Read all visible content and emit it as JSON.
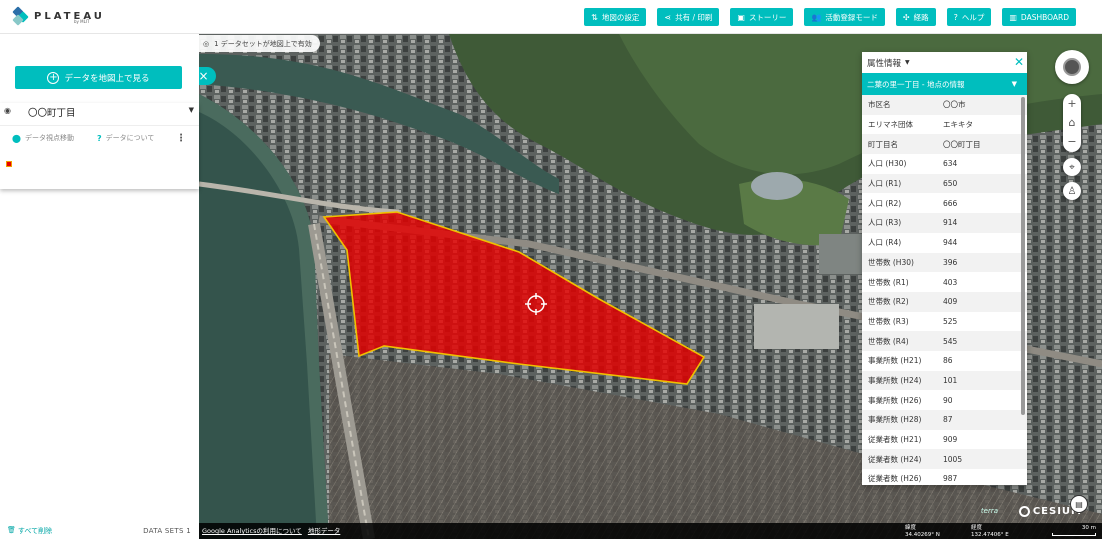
{
  "header": {
    "logo_text": "PLATEAU",
    "logo_sub": "by MLIT",
    "nav": [
      {
        "icon": "map-settings-icon",
        "glyph": "⇅",
        "label": "地図の設定"
      },
      {
        "icon": "share-icon",
        "glyph": "⋖",
        "label": "共有 / 印刷"
      },
      {
        "icon": "story-icon",
        "glyph": "▣",
        "label": "ストーリー"
      },
      {
        "icon": "activity-icon",
        "glyph": "👥",
        "label": "活動登録モード"
      },
      {
        "icon": "route-icon",
        "glyph": "✣",
        "label": "経路"
      },
      {
        "icon": "help-icon",
        "glyph": "?",
        "label": "ヘルプ"
      },
      {
        "icon": "dashboard-icon",
        "glyph": "▥",
        "label": "DASHBOARD"
      }
    ]
  },
  "left_panel": {
    "view_button": "データを地図上で見る",
    "layer_name": "〇〇町丁目",
    "actions": {
      "move": "データ視点移動",
      "about": "データについて"
    },
    "legend_color": "#e60000",
    "footer": {
      "clear_all": "すべて削除",
      "datasets": "DATA SETS 1"
    }
  },
  "map": {
    "dataset_notice": "1 データセットが地図上で有効",
    "credits": [
      "Google Analyticsの利用について",
      "地形データ"
    ],
    "latitude_label": "緯度",
    "latitude_value": "34.40269° N",
    "longitude_label": "経度",
    "longitude_value": "132.47406° E",
    "scale": "30 m",
    "cesium_label": "CESIUM",
    "terra_label": "terra",
    "highlight_color": "#e60000",
    "highlight_border": "#f0c000"
  },
  "info_panel": {
    "header": "属性情報",
    "title": "二葉の里一丁目 - 地点の情報",
    "rows": [
      {
        "k": "市区名",
        "v": "〇〇市"
      },
      {
        "k": "エリマネ団体",
        "v": "エキキタ"
      },
      {
        "k": "町丁目名",
        "v": "〇〇町丁目"
      },
      {
        "k": "人口 (H30)",
        "v": "634"
      },
      {
        "k": "人口 (R1)",
        "v": "650"
      },
      {
        "k": "人口 (R2)",
        "v": "666"
      },
      {
        "k": "人口 (R3)",
        "v": "914"
      },
      {
        "k": "人口 (R4)",
        "v": "944"
      },
      {
        "k": "世帯数 (H30)",
        "v": "396"
      },
      {
        "k": "世帯数 (R1)",
        "v": "403"
      },
      {
        "k": "世帯数 (R2)",
        "v": "409"
      },
      {
        "k": "世帯数 (R3)",
        "v": "525"
      },
      {
        "k": "世帯数 (R4)",
        "v": "545"
      },
      {
        "k": "事業所数 (H21)",
        "v": "86"
      },
      {
        "k": "事業所数 (H24)",
        "v": "101"
      },
      {
        "k": "事業所数 (H26)",
        "v": "90"
      },
      {
        "k": "事業所数 (H28)",
        "v": "87"
      },
      {
        "k": "従業者数 (H21)",
        "v": "909"
      },
      {
        "k": "従業者数 (H24)",
        "v": "1005"
      },
      {
        "k": "従業者数 (H26)",
        "v": "987"
      }
    ]
  }
}
